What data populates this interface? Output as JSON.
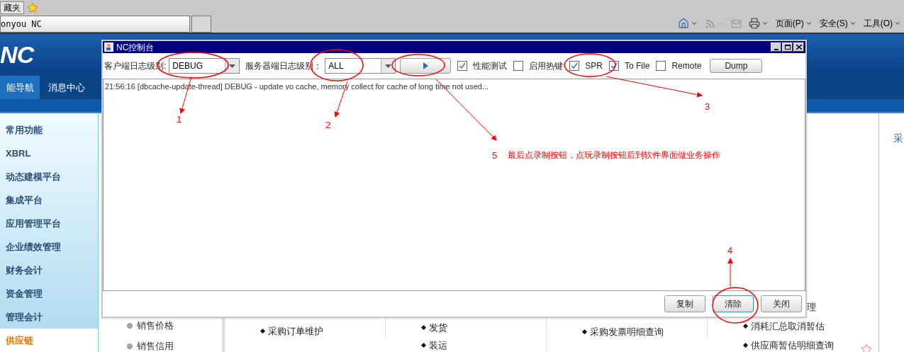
{
  "browser": {
    "favorites_tab": "藏夹",
    "tabs": [
      {
        "label": "onyou NC",
        "selected": true
      },
      {
        "selected": false
      }
    ],
    "menus": [
      "页面(P)",
      "安全(S)",
      "工具(O)"
    ]
  },
  "app": {
    "logo": "NC",
    "nav_tabs": [
      {
        "label": "能导航",
        "selected": true
      },
      {
        "label": "消息中心",
        "selected": false
      }
    ],
    "sidebar": [
      {
        "label": "常用功能",
        "selected": false
      },
      {
        "label": "XBRL",
        "selected": false
      },
      {
        "label": "动态建模平台",
        "selected": false
      },
      {
        "label": "集成平台",
        "selected": false
      },
      {
        "label": "应用管理平台",
        "selected": false
      },
      {
        "label": "企业绩效管理",
        "selected": false
      },
      {
        "label": "财务会计",
        "selected": false
      },
      {
        "label": "资金管理",
        "selected": false
      },
      {
        "label": "管理会计",
        "selected": false
      },
      {
        "label": "供应链",
        "selected": true
      }
    ],
    "left_list": [
      "销售价格",
      "销售信用"
    ],
    "columns": [
      [
        "采购订单维护"
      ],
      [
        "发货",
        "装运"
      ],
      [
        "采购发票明细查询"
      ],
      [
        "理",
        "消耗汇总取消暂估",
        "供应商暂估明细查询"
      ]
    ],
    "right_heading": "采"
  },
  "dialog": {
    "title": "NC控制台",
    "client_level_label": "客户端日志级别:",
    "client_level": "DEBUG",
    "server_level_label": "服务器端日志级别：",
    "server_level": "ALL",
    "options": [
      {
        "label": "性能测试",
        "checked": true
      },
      {
        "label": "启用热键",
        "checked": false
      },
      {
        "label": "SPR",
        "checked": true
      },
      {
        "label": "To File",
        "checked": true
      },
      {
        "label": "Remote",
        "checked": false
      }
    ],
    "dump": "Dump",
    "log": [
      "21:56:16 [dbcache-update-thread] DEBUG - update vo cache, memory collect for cache of long time not used..."
    ],
    "buttons": [
      {
        "label": "复制",
        "focused": false
      },
      {
        "label": "清除",
        "focused": true
      },
      {
        "label": "关闭",
        "focused": false
      }
    ]
  },
  "annotations": {
    "numbers": [
      "1",
      "2",
      "3",
      "4",
      "5"
    ],
    "note": "最后点录制按钮，点玩录制按钮后到软件界面做业务操作"
  }
}
